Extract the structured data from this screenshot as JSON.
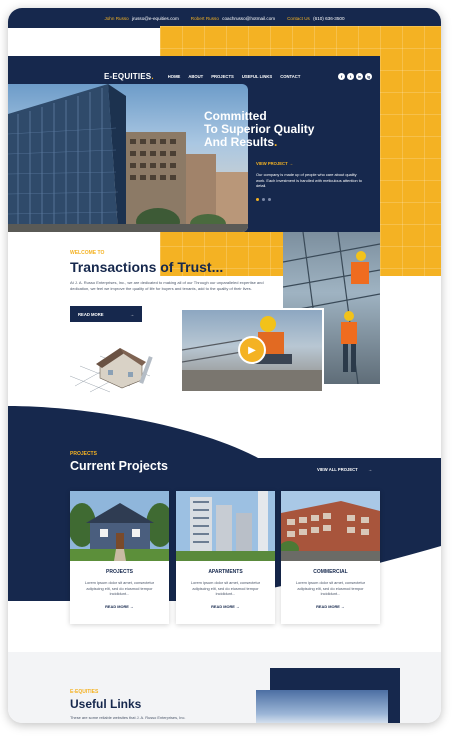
{
  "topbar": {
    "contact1_name": "John Russo",
    "contact1_email": "jrusso@e-equities.com",
    "contact2_name": "Robert Russo",
    "contact2_email": "coachrusso@hotmail.com",
    "contact3_label": "Contact Us",
    "contact3_phone": "(610) 636-3500"
  },
  "brand": {
    "logo_text": "E-EQUITIES",
    "logo_dot": "."
  },
  "nav": {
    "items": [
      "HOME",
      "ABOUT",
      "PROJECTS",
      "USEFUL LINKS",
      "CONTACT"
    ]
  },
  "social": {
    "icons": [
      "f",
      "t",
      "in",
      "ig"
    ]
  },
  "hero": {
    "title_line1": "Committed",
    "title_line2": "To Superior Quality",
    "title_line3": "And Results",
    "title_dot": ".",
    "cta_label": "VIEW PROJECT",
    "cta_arrow": "→",
    "text": "Our company is made up of people who care about quality work. Each investment is handled with meticulous attention to detail."
  },
  "welcome": {
    "eyebrow": "WELCOME TO",
    "title": "Transactions of Trust...",
    "text": "At J. A. Russo Enterprises, Inc., we are dedicated to making all of our Through our unparalleled expertise and dedication, we feel we improve the quality of life for buyers and tenants, add to the quality of their lives.",
    "button_label": "READ MORE",
    "button_arrow": "→",
    "play_icon": "▶"
  },
  "projects": {
    "eyebrow": "PROJECTS",
    "title": "Current Projects",
    "view_all_label": "VIEW ALL PROJECT",
    "view_all_arrow": "→",
    "cards": [
      {
        "title": "PROJECTS",
        "text": "Lorem ipsum dolor sit amet, consectetur adipiscing elit, sed do eiusmod tempor incididunt...",
        "more": "READ MORE  →"
      },
      {
        "title": "APARTMENTS",
        "text": "Lorem ipsum dolor sit amet, consectetur adipiscing elit, sed do eiusmod tempor incididunt...",
        "more": "READ MORE  →"
      },
      {
        "title": "COMMERCIAL",
        "text": "Lorem ipsum dolor sit amet, consectetur adipiscing elit, sed do eiusmod tempor incididunt...",
        "more": "READ MORE  →"
      }
    ]
  },
  "links": {
    "eyebrow": "E-EQUITIES",
    "title": "Useful Links",
    "text": "These are some reliable websites that J. A. Russo Enterprises, Inc."
  },
  "colors": {
    "navy": "#16284d",
    "yellow": "#f4b223",
    "white": "#ffffff"
  }
}
